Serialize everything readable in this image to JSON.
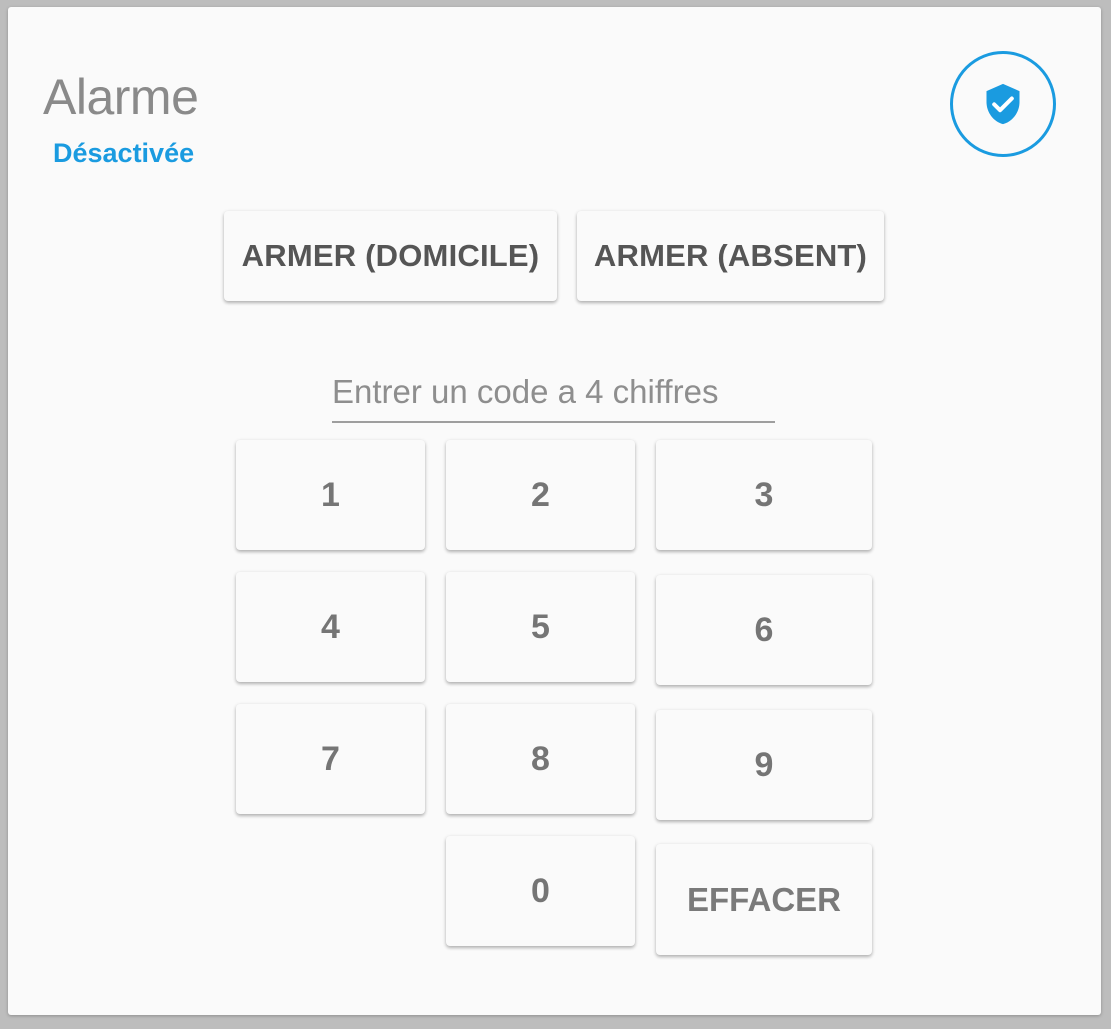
{
  "card": {
    "title": "Alarme",
    "state": "Désactivée",
    "state_icon": "shield-check-icon",
    "accent_color": "#1a9be0"
  },
  "actions": {
    "arm_home": "ARMER (DOMICILE)",
    "arm_away": "ARMER (ABSENT)"
  },
  "code_input": {
    "placeholder": "Entrer un code a 4 chiffres",
    "value": ""
  },
  "keypad": {
    "key_1": "1",
    "key_2": "2",
    "key_3": "3",
    "key_4": "4",
    "key_5": "5",
    "key_6": "6",
    "key_7": "7",
    "key_8": "8",
    "key_9": "9",
    "key_0": "0",
    "clear": "EFFACER"
  }
}
